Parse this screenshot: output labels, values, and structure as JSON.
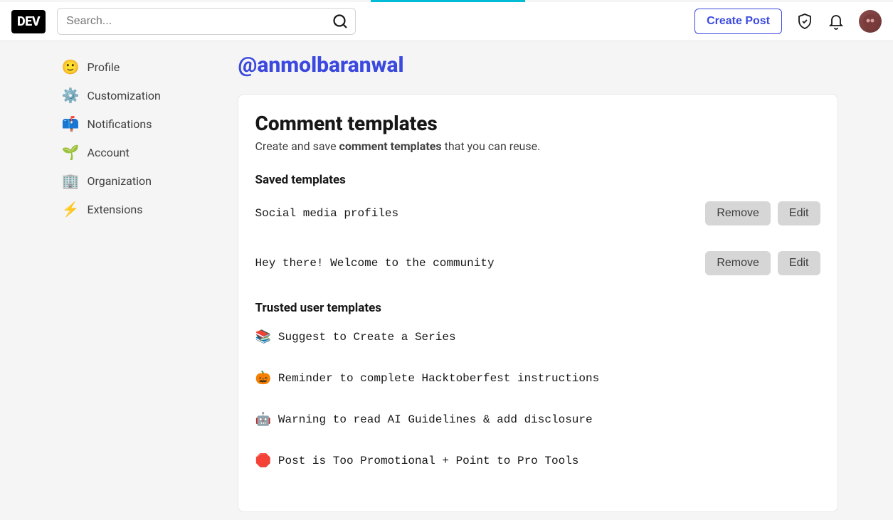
{
  "header": {
    "logo": "DEV",
    "search_placeholder": "Search...",
    "create_post": "Create Post"
  },
  "sidebar": {
    "items": [
      {
        "icon": "🙂",
        "label": "Profile"
      },
      {
        "icon": "⚙️",
        "label": "Customization"
      },
      {
        "icon": "📫",
        "label": "Notifications"
      },
      {
        "icon": "🌱",
        "label": "Account"
      },
      {
        "icon": "🏢",
        "label": "Organization"
      },
      {
        "icon": "⚡",
        "label": "Extensions"
      }
    ]
  },
  "username": "@anmolbaranwal",
  "card": {
    "title": "Comment templates",
    "subtitle_prefix": "Create and save ",
    "subtitle_bold": "comment templates",
    "subtitle_suffix": " that you can reuse.",
    "saved_heading": "Saved templates",
    "trusted_heading": "Trusted user templates",
    "remove_label": "Remove",
    "edit_label": "Edit"
  },
  "saved_templates": [
    {
      "name": "Social media profiles"
    },
    {
      "name": "Hey there! Welcome to the community"
    }
  ],
  "trusted_templates": [
    {
      "icon": "📚",
      "name": "Suggest to Create a Series"
    },
    {
      "icon": "🎃",
      "name": "Reminder to complete Hacktoberfest instructions"
    },
    {
      "icon": "🤖",
      "name": "Warning to read AI Guidelines & add disclosure"
    },
    {
      "icon": "🛑",
      "name": "Post is Too Promotional + Point to Pro Tools"
    }
  ]
}
